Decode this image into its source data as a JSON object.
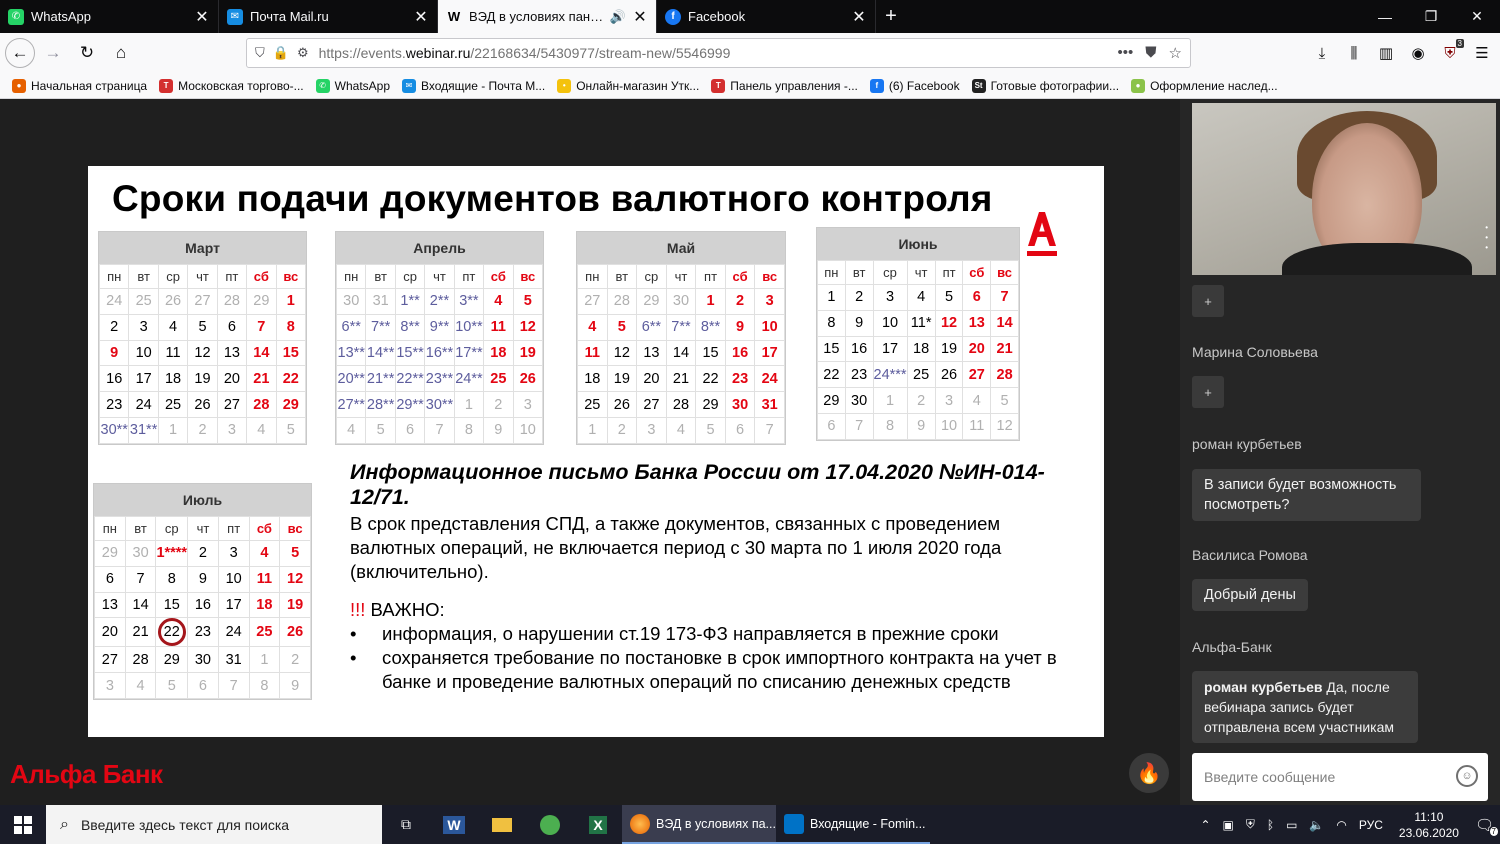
{
  "tabs": [
    {
      "label": "WhatsApp",
      "color": "#25d366",
      "glyph": "✆"
    },
    {
      "label": "Почта Mail.ru",
      "color": "#168de2",
      "glyph": "✉"
    },
    {
      "label": "ВЭД в условиях пандемии",
      "color": "#ffffff",
      "glyph": "W",
      "active": true
    },
    {
      "label": "Facebook",
      "color": "#1877f2",
      "glyph": "f"
    }
  ],
  "nav": {
    "url_prefix": "https://events.",
    "url_domain": "webinar.ru",
    "url_path": "/22168634/5430977/stream-new/5546999",
    "ext_badge": "3"
  },
  "bookmarks": [
    {
      "label": "Начальная страница",
      "color": "#e66000",
      "glyph": "●"
    },
    {
      "label": "Московская торгово-...",
      "color": "#d32f2f",
      "glyph": "Т"
    },
    {
      "label": "WhatsApp",
      "color": "#25d366",
      "glyph": "✆"
    },
    {
      "label": "Входящие - Почта М...",
      "color": "#168de2",
      "glyph": "✉"
    },
    {
      "label": "Онлайн-магазин Утк...",
      "color": "#f4c20d",
      "glyph": "•"
    },
    {
      "label": "Панель управления -...",
      "color": "#d32f2f",
      "glyph": "Т"
    },
    {
      "label": "(6) Facebook",
      "color": "#1877f2",
      "glyph": "f"
    },
    {
      "label": "Готовые фотографии...",
      "color": "#222222",
      "glyph": "St"
    },
    {
      "label": "Оформление наслед...",
      "color": "#8bc34a",
      "glyph": "●"
    }
  ],
  "slide": {
    "title": "Сроки подачи документов валютного контроля",
    "weekdays": [
      "пн",
      "вт",
      "ср",
      "чт",
      "пт",
      "сб",
      "вс"
    ],
    "info_heading": "Информационное письмо Банка России от 17.04.2020 №ИН-014-12/71.",
    "info_text": "В срок представления СПД, а также документов, связанных с проведением валютных операций, не включается период с 30 марта по 1 июля 2020 года (включительно).",
    "important_mark": "!!!",
    "important_label": " ВАЖНО:",
    "bullets": [
      "информация, о нарушении ст.19 173-ФЗ направляется в прежние сроки",
      "сохраняется требование по постановке  в срок импортного контракта на учет в банке и проведение валютных операций по списанию денежных средств"
    ]
  },
  "calendars": [
    {
      "name": "Март",
      "rows": [
        [
          [
            "24",
            "ot"
          ],
          [
            "25",
            "ot"
          ],
          [
            "26",
            "ot"
          ],
          [
            "27",
            "ot"
          ],
          [
            "28",
            "ot"
          ],
          [
            "29",
            "ot"
          ],
          [
            "1",
            "we"
          ]
        ],
        [
          [
            "2",
            ""
          ],
          [
            "3",
            ""
          ],
          [
            "4",
            ""
          ],
          [
            "5",
            ""
          ],
          [
            "6",
            ""
          ],
          [
            "7",
            "we"
          ],
          [
            "8",
            "we"
          ]
        ],
        [
          [
            "9",
            "we"
          ],
          [
            "10",
            ""
          ],
          [
            "11",
            ""
          ],
          [
            "12",
            ""
          ],
          [
            "13",
            ""
          ],
          [
            "14",
            "we"
          ],
          [
            "15",
            "we"
          ]
        ],
        [
          [
            "16",
            ""
          ],
          [
            "17",
            ""
          ],
          [
            "18",
            ""
          ],
          [
            "19",
            ""
          ],
          [
            "20",
            ""
          ],
          [
            "21",
            "we"
          ],
          [
            "22",
            "we"
          ]
        ],
        [
          [
            "23",
            ""
          ],
          [
            "24",
            ""
          ],
          [
            "25",
            ""
          ],
          [
            "26",
            ""
          ],
          [
            "27",
            ""
          ],
          [
            "28",
            "we"
          ],
          [
            "29",
            "we"
          ]
        ],
        [
          [
            "30**",
            "hl"
          ],
          [
            "31**",
            "hl"
          ],
          [
            "1",
            "ot"
          ],
          [
            "2",
            "ot"
          ],
          [
            "3",
            "ot"
          ],
          [
            "4",
            "ot"
          ],
          [
            "5",
            "ot"
          ]
        ]
      ]
    },
    {
      "name": "Апрель",
      "rows": [
        [
          [
            "30",
            "ot"
          ],
          [
            "31",
            "ot"
          ],
          [
            "1**",
            "hl"
          ],
          [
            "2**",
            "hl"
          ],
          [
            "3**",
            "hl"
          ],
          [
            "4",
            "we"
          ],
          [
            "5",
            "we"
          ]
        ],
        [
          [
            "6**",
            "hl"
          ],
          [
            "7**",
            "hl"
          ],
          [
            "8**",
            "hl"
          ],
          [
            "9**",
            "hl"
          ],
          [
            "10**",
            "hl"
          ],
          [
            "11",
            "we"
          ],
          [
            "12",
            "we"
          ]
        ],
        [
          [
            "13**",
            "hl"
          ],
          [
            "14**",
            "hl"
          ],
          [
            "15**",
            "hl"
          ],
          [
            "16**",
            "hl"
          ],
          [
            "17**",
            "hl"
          ],
          [
            "18",
            "we"
          ],
          [
            "19",
            "we"
          ]
        ],
        [
          [
            "20**",
            "hl"
          ],
          [
            "21**",
            "hl"
          ],
          [
            "22**",
            "hl"
          ],
          [
            "23**",
            "hl"
          ],
          [
            "24**",
            "hl"
          ],
          [
            "25",
            "we"
          ],
          [
            "26",
            "we"
          ]
        ],
        [
          [
            "27**",
            "hl"
          ],
          [
            "28**",
            "hl"
          ],
          [
            "29**",
            "hl"
          ],
          [
            "30**",
            "hl"
          ],
          [
            "1",
            "ot"
          ],
          [
            "2",
            "ot"
          ],
          [
            "3",
            "ot"
          ]
        ],
        [
          [
            "4",
            "ot"
          ],
          [
            "5",
            "ot"
          ],
          [
            "6",
            "ot"
          ],
          [
            "7",
            "ot"
          ],
          [
            "8",
            "ot"
          ],
          [
            "9",
            "ot"
          ],
          [
            "10",
            "ot"
          ]
        ]
      ]
    },
    {
      "name": "Май",
      "rows": [
        [
          [
            "27",
            "ot"
          ],
          [
            "28",
            "ot"
          ],
          [
            "29",
            "ot"
          ],
          [
            "30",
            "ot"
          ],
          [
            "1",
            "we"
          ],
          [
            "2",
            "we"
          ],
          [
            "3",
            "we"
          ]
        ],
        [
          [
            "4",
            "we"
          ],
          [
            "5",
            "we"
          ],
          [
            "6**",
            "hl"
          ],
          [
            "7**",
            "hl"
          ],
          [
            "8**",
            "hl"
          ],
          [
            "9",
            "we"
          ],
          [
            "10",
            "we"
          ]
        ],
        [
          [
            "11",
            "we"
          ],
          [
            "12",
            ""
          ],
          [
            "13",
            ""
          ],
          [
            "14",
            ""
          ],
          [
            "15",
            ""
          ],
          [
            "16",
            "we"
          ],
          [
            "17",
            "we"
          ]
        ],
        [
          [
            "18",
            ""
          ],
          [
            "19",
            ""
          ],
          [
            "20",
            ""
          ],
          [
            "21",
            ""
          ],
          [
            "22",
            ""
          ],
          [
            "23",
            "we"
          ],
          [
            "24",
            "we"
          ]
        ],
        [
          [
            "25",
            ""
          ],
          [
            "26",
            ""
          ],
          [
            "27",
            ""
          ],
          [
            "28",
            ""
          ],
          [
            "29",
            ""
          ],
          [
            "30",
            "we"
          ],
          [
            "31",
            "we"
          ]
        ],
        [
          [
            "1",
            "ot"
          ],
          [
            "2",
            "ot"
          ],
          [
            "3",
            "ot"
          ],
          [
            "4",
            "ot"
          ],
          [
            "5",
            "ot"
          ],
          [
            "6",
            "ot"
          ],
          [
            "7",
            "ot"
          ]
        ]
      ]
    },
    {
      "name": "Июнь",
      "rows": [
        [
          [
            "1",
            ""
          ],
          [
            "2",
            ""
          ],
          [
            "3",
            ""
          ],
          [
            "4",
            ""
          ],
          [
            "5",
            ""
          ],
          [
            "6",
            "we"
          ],
          [
            "7",
            "we"
          ]
        ],
        [
          [
            "8",
            ""
          ],
          [
            "9",
            ""
          ],
          [
            "10",
            ""
          ],
          [
            "11*",
            ""
          ],
          [
            "12",
            "we"
          ],
          [
            "13",
            "we"
          ],
          [
            "14",
            "we"
          ]
        ],
        [
          [
            "15",
            ""
          ],
          [
            "16",
            ""
          ],
          [
            "17",
            ""
          ],
          [
            "18",
            ""
          ],
          [
            "19",
            ""
          ],
          [
            "20",
            "we"
          ],
          [
            "21",
            "we"
          ]
        ],
        [
          [
            "22",
            ""
          ],
          [
            "23",
            ""
          ],
          [
            "24***",
            "hl"
          ],
          [
            "25",
            ""
          ],
          [
            "26",
            ""
          ],
          [
            "27",
            "we"
          ],
          [
            "28",
            "we"
          ]
        ],
        [
          [
            "29",
            ""
          ],
          [
            "30",
            ""
          ],
          [
            "1",
            "ot"
          ],
          [
            "2",
            "ot"
          ],
          [
            "3",
            "ot"
          ],
          [
            "4",
            "ot"
          ],
          [
            "5",
            "ot"
          ]
        ],
        [
          [
            "6",
            "ot"
          ],
          [
            "7",
            "ot"
          ],
          [
            "8",
            "ot"
          ],
          [
            "9",
            "ot"
          ],
          [
            "10",
            "ot"
          ],
          [
            "11",
            "ot"
          ],
          [
            "12",
            "ot"
          ]
        ]
      ]
    },
    {
      "name": "Июль",
      "rows": [
        [
          [
            "29",
            "ot"
          ],
          [
            "30",
            "ot"
          ],
          [
            "1****",
            "ins"
          ],
          [
            "2",
            ""
          ],
          [
            "3",
            ""
          ],
          [
            "4",
            "we"
          ],
          [
            "5",
            "we"
          ]
        ],
        [
          [
            "6",
            ""
          ],
          [
            "7",
            ""
          ],
          [
            "8",
            ""
          ],
          [
            "9",
            ""
          ],
          [
            "10",
            ""
          ],
          [
            "11",
            "we"
          ],
          [
            "12",
            "we"
          ]
        ],
        [
          [
            "13",
            ""
          ],
          [
            "14",
            ""
          ],
          [
            "15",
            ""
          ],
          [
            "16",
            ""
          ],
          [
            "17",
            ""
          ],
          [
            "18",
            "we"
          ],
          [
            "19",
            "we"
          ]
        ],
        [
          [
            "20",
            ""
          ],
          [
            "21",
            ""
          ],
          [
            "22",
            "ring"
          ],
          [
            "23",
            ""
          ],
          [
            "24",
            ""
          ],
          [
            "25",
            "we"
          ],
          [
            "26",
            "we"
          ]
        ],
        [
          [
            "27",
            ""
          ],
          [
            "28",
            ""
          ],
          [
            "29",
            ""
          ],
          [
            "30",
            ""
          ],
          [
            "31",
            ""
          ],
          [
            "1",
            "ot"
          ],
          [
            "2",
            "ot"
          ]
        ],
        [
          [
            "3",
            "ot"
          ],
          [
            "4",
            "ot"
          ],
          [
            "5",
            "ot"
          ],
          [
            "6",
            "ot"
          ],
          [
            "7",
            "ot"
          ],
          [
            "8",
            "ot"
          ],
          [
            "9",
            "ot"
          ]
        ]
      ]
    }
  ],
  "brand": "Альфа Банк",
  "chat": {
    "participants": [
      "Марина Соловьева",
      "роман курбетьев",
      "Василиса Ромова",
      "Альфа-Банк"
    ],
    "msg1": "В записи будет возможность посмотреть?",
    "msg2": "Добрый дены",
    "msg3_author": "роман курбетьев",
    "msg3_text": " Да, после вебинара запись будет отправлена всем участникам",
    "input_placeholder": "Введите сообщение",
    "plus": "+"
  },
  "taskbar": {
    "search_placeholder": "Введите здесь текст для поиска",
    "app1": "ВЭД в условиях па...",
    "app2": "Входящие - Fomin...",
    "lang": "РУС",
    "time": "11:10",
    "date": "23.06.2020",
    "notif": "7"
  }
}
